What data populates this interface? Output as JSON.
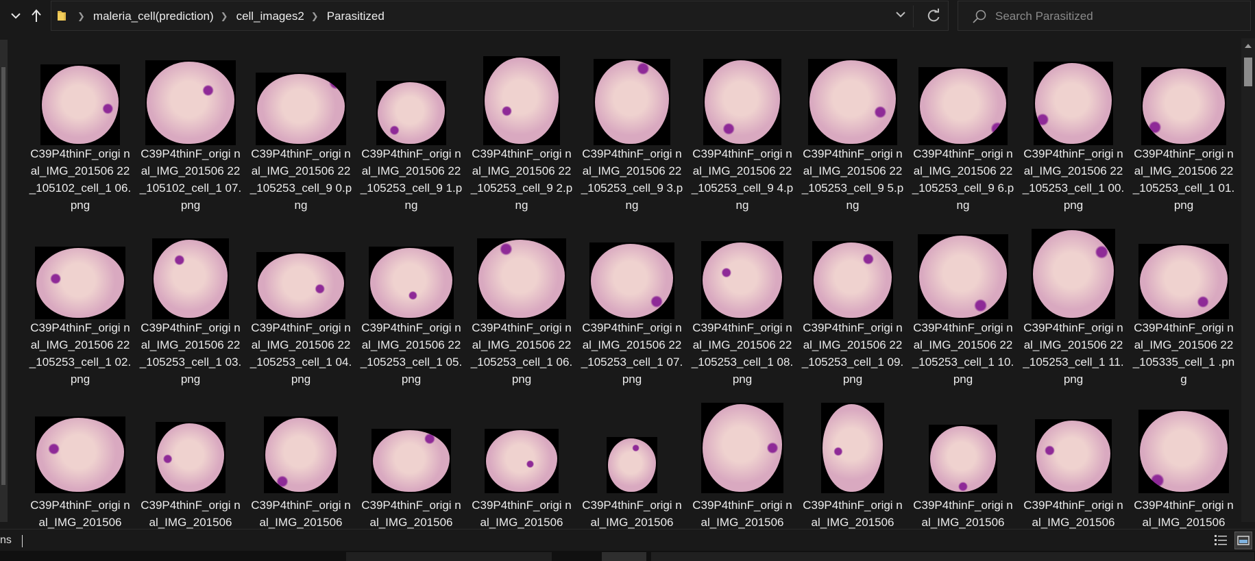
{
  "address_bar": {
    "breadcrumbs": [
      "maleria_cell(prediction)",
      "cell_images2",
      "Parasitized"
    ]
  },
  "search": {
    "placeholder": "Search Parasitized"
  },
  "status_bar": {
    "text": "ns"
  },
  "files": [
    {
      "name": "C39P4thinF_original_IMG_20150622_105102_cell_106.png",
      "label": "C39P4thinF_origi nal_IMG_201506 22_105102_cell_1 06.png"
    },
    {
      "name": "C39P4thinF_original_IMG_20150622_105102_cell_107.png",
      "label": "C39P4thinF_origi nal_IMG_201506 22_105102_cell_1 07.png"
    },
    {
      "name": "C39P4thinF_original_IMG_20150622_105253_cell_90.png",
      "label": "C39P4thinF_origi nal_IMG_201506 22_105253_cell_9 0.png"
    },
    {
      "name": "C39P4thinF_original_IMG_20150622_105253_cell_91.png",
      "label": "C39P4thinF_origi nal_IMG_201506 22_105253_cell_9 1.png"
    },
    {
      "name": "C39P4thinF_original_IMG_20150622_105253_cell_92.png",
      "label": "C39P4thinF_origi nal_IMG_201506 22_105253_cell_9 2.png"
    },
    {
      "name": "C39P4thinF_original_IMG_20150622_105253_cell_93.png",
      "label": "C39P4thinF_origi nal_IMG_201506 22_105253_cell_9 3.png"
    },
    {
      "name": "C39P4thinF_original_IMG_20150622_105253_cell_94.png",
      "label": "C39P4thinF_origi nal_IMG_201506 22_105253_cell_9 4.png"
    },
    {
      "name": "C39P4thinF_original_IMG_20150622_105253_cell_95.png",
      "label": "C39P4thinF_origi nal_IMG_201506 22_105253_cell_9 5.png"
    },
    {
      "name": "C39P4thinF_original_IMG_20150622_105253_cell_96.png",
      "label": "C39P4thinF_origi nal_IMG_201506 22_105253_cell_9 6.png"
    },
    {
      "name": "C39P4thinF_original_IMG_20150622_105253_cell_100.png",
      "label": "C39P4thinF_origi nal_IMG_201506 22_105253_cell_1 00.png"
    },
    {
      "name": "C39P4thinF_original_IMG_20150622_105253_cell_101.png",
      "label": "C39P4thinF_origi nal_IMG_201506 22_105253_cell_1 01.png"
    },
    {
      "name": "C39P4thinF_original_IMG_20150622_105253_cell_102.png",
      "label": "C39P4thinF_origi nal_IMG_201506 22_105253_cell_1 02.png"
    },
    {
      "name": "C39P4thinF_original_IMG_20150622_105253_cell_103.png",
      "label": "C39P4thinF_origi nal_IMG_201506 22_105253_cell_1 03.png"
    },
    {
      "name": "C39P4thinF_original_IMG_20150622_105253_cell_104.png",
      "label": "C39P4thinF_origi nal_IMG_201506 22_105253_cell_1 04.png"
    },
    {
      "name": "C39P4thinF_original_IMG_20150622_105253_cell_105.png",
      "label": "C39P4thinF_origi nal_IMG_201506 22_105253_cell_1 05.png"
    },
    {
      "name": "C39P4thinF_original_IMG_20150622_105253_cell_106.png",
      "label": "C39P4thinF_origi nal_IMG_201506 22_105253_cell_1 06.png"
    },
    {
      "name": "C39P4thinF_original_IMG_20150622_105253_cell_107.png",
      "label": "C39P4thinF_origi nal_IMG_201506 22_105253_cell_1 07.png"
    },
    {
      "name": "C39P4thinF_original_IMG_20150622_105253_cell_108.png",
      "label": "C39P4thinF_origi nal_IMG_201506 22_105253_cell_1 08.png"
    },
    {
      "name": "C39P4thinF_original_IMG_20150622_105253_cell_109.png",
      "label": "C39P4thinF_origi nal_IMG_201506 22_105253_cell_1 09.png"
    },
    {
      "name": "C39P4thinF_original_IMG_20150622_105253_cell_110.png",
      "label": "C39P4thinF_origi nal_IMG_201506 22_105253_cell_1 10.png"
    },
    {
      "name": "C39P4thinF_original_IMG_20150622_105253_cell_111.png",
      "label": "C39P4thinF_origi nal_IMG_201506 22_105253_cell_1 11.png"
    },
    {
      "name": "C39P4thinF_original_IMG_20150622_105335_cell_1.png",
      "label": "C39P4thinF_origi nal_IMG_201506 22_105335_cell_1 .png"
    },
    {
      "label": "C39P4thinF_origi nal_IMG_201506"
    },
    {
      "label": "C39P4thinF_origi nal_IMG_201506"
    },
    {
      "label": "C39P4thinF_origi nal_IMG_201506"
    },
    {
      "label": "C39P4thinF_origi nal_IMG_201506"
    },
    {
      "label": "C39P4thinF_origi nal_IMG_201506"
    },
    {
      "label": "C39P4thinF_origi nal_IMG_201506"
    },
    {
      "label": "C39P4thinF_origi nal_IMG_201506"
    },
    {
      "label": "C39P4thinF_origi nal_IMG_201506"
    },
    {
      "label": "C39P4thinF_origi nal_IMG_201506"
    },
    {
      "label": "C39P4thinF_origi nal_IMG_201506"
    },
    {
      "label": "C39P4thinF_origi nal_IMG_201506"
    }
  ],
  "colors": {
    "cell_fill": "#d9a9c0",
    "cell_center": "#efd2cf",
    "parasite": "#8e2a97"
  },
  "icons": {
    "expand": "chevron-down-icon",
    "up": "arrow-up-icon",
    "folder": "folder-icon",
    "refresh": "refresh-icon",
    "search": "search-icon",
    "details_view": "details-view-icon",
    "large_icons_view": "large-icons-view-icon"
  }
}
